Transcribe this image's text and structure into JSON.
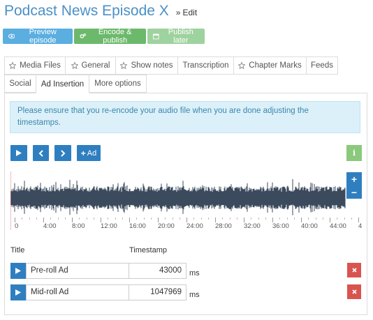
{
  "header": {
    "title": "Podcast News Episode X",
    "breadcrumb_sep": "»",
    "breadcrumb_current": "Edit"
  },
  "actions": {
    "preview_label": "Preview episode",
    "encode_label": "Encode & publish",
    "later_label": "Publish later"
  },
  "tabs": {
    "row1": [
      {
        "label": "Media Files",
        "icon": "star-icon"
      },
      {
        "label": "General",
        "icon": "star-icon"
      },
      {
        "label": "Show notes",
        "icon": "star-icon"
      },
      {
        "label": "Transcription",
        "icon": ""
      },
      {
        "label": "Chapter Marks",
        "icon": "star-icon"
      },
      {
        "label": "Feeds",
        "icon": ""
      }
    ],
    "row2": [
      {
        "label": "Social"
      },
      {
        "label": "Ad Insertion",
        "active": true
      },
      {
        "label": "More options"
      }
    ]
  },
  "alert": {
    "text": "Please ensure that you re-encode your audio file when you are done adjusting the timestamps."
  },
  "player": {
    "add_label": "Ad",
    "info_label": "i",
    "zoom_in": "+",
    "zoom_out": "−"
  },
  "timeline": {
    "ticks": [
      "0",
      "4:00",
      "8:00",
      "12:00",
      "16:00",
      "20:00",
      "24:00",
      "28:00",
      "32:00",
      "36:00",
      "40:00",
      "44:00",
      "4"
    ]
  },
  "table": {
    "title_header": "Title",
    "timestamp_header": "Timestamp",
    "unit": "ms",
    "rows": [
      {
        "title": "Pre-roll Ad",
        "timestamp": "43000"
      },
      {
        "title": "Mid-roll Ad",
        "timestamp": "1047969"
      }
    ]
  },
  "colors": {
    "primary": "#2f7fc0",
    "title": "#4a90c6",
    "success": "#6cb96c",
    "danger": "#d9534f",
    "info_bg": "#dcf0f9"
  }
}
